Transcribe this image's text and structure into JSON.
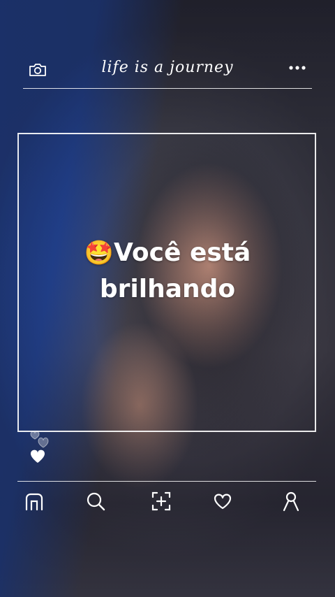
{
  "header": {
    "camera_icon": "camera-icon",
    "brand_text": "life is a journey",
    "more_icon": "more-dots-icon"
  },
  "caption": {
    "emoji": "🤩",
    "line1": "Você está",
    "line2": "brilhando"
  },
  "reactions": {
    "icons": [
      "heart-outline-icon",
      "heart-filled-icon"
    ]
  },
  "bottom_nav": {
    "items": [
      "home-icon",
      "search-icon",
      "add-post-icon",
      "heart-icon",
      "profile-icon"
    ]
  },
  "colors": {
    "accent": "#ffffff",
    "background_blue": "#2254c8"
  }
}
